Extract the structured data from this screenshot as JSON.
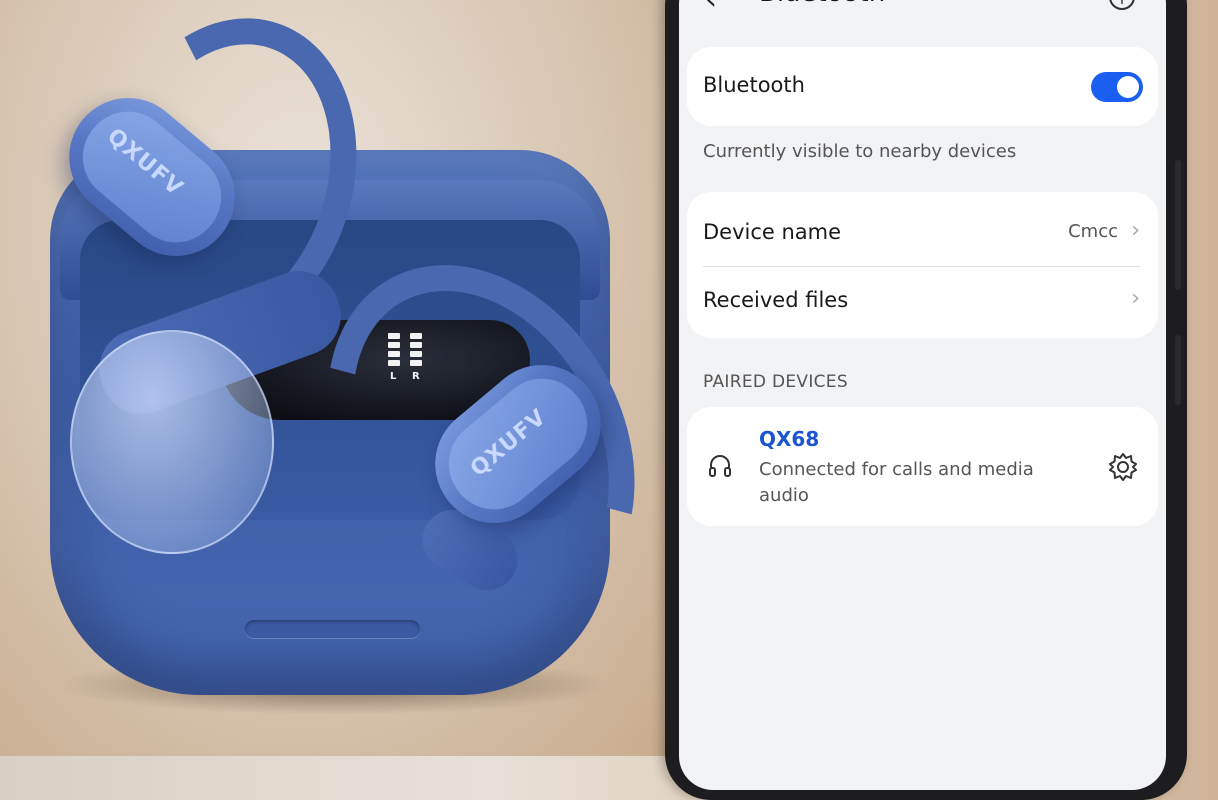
{
  "product": {
    "brand_logo": "QXUFV",
    "battery_left": "L",
    "battery_right": "R"
  },
  "phone": {
    "header": {
      "title": "Bluetooth",
      "back_icon": "chevron-left-icon",
      "info_icon": "info-icon"
    },
    "bluetooth": {
      "label": "Bluetooth",
      "enabled": true,
      "accent_color": "#1b5ff0"
    },
    "visibility_text": "Currently visible to nearby devices",
    "device_name": {
      "label": "Device name",
      "value": "Cmcc"
    },
    "received_files": {
      "label": "Received files"
    },
    "paired_section_title": "PAIRED DEVICES",
    "paired_devices": [
      {
        "name": "QX68",
        "status": "Connected for calls and media audio",
        "icon": "headphones-icon",
        "settings_icon": "gear-icon"
      }
    ]
  }
}
